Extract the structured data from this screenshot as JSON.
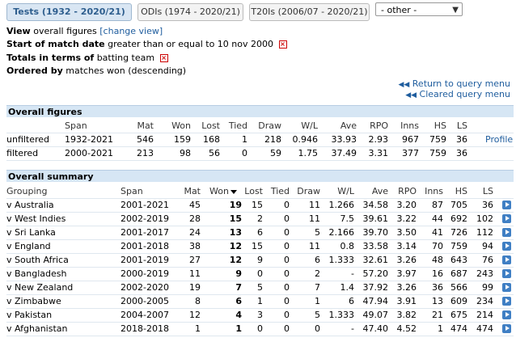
{
  "tabs": [
    {
      "label": "Tests (1932 - 2020/21)",
      "active": true
    },
    {
      "label": "ODIs (1974 - 2020/21)",
      "active": false
    },
    {
      "label": "T20Is (2006/07 - 2020/21)",
      "active": false
    }
  ],
  "other_select": "- other -",
  "criteria": {
    "view_label": "View",
    "view_value": "overall figures",
    "change_view": "[change view]",
    "start_label": "Start of match date",
    "start_value": "greater than or equal to 10 nov 2000",
    "totals_label": "Totals in terms of",
    "totals_value": "batting team",
    "ordered_label": "Ordered by",
    "ordered_value": "matches won (descending)"
  },
  "links": {
    "return_query": "Return to query menu",
    "cleared_query": "Cleared query menu"
  },
  "overall_figures": {
    "title": "Overall figures",
    "headers": [
      "Span",
      "Mat",
      "Won",
      "Lost",
      "Tied",
      "Draw",
      "W/L",
      "Ave",
      "RPO",
      "Inns",
      "HS",
      "LS"
    ],
    "rows": [
      {
        "label": "unfiltered",
        "cells": [
          "1932-2021",
          "546",
          "159",
          "168",
          "1",
          "218",
          "0.946",
          "33.93",
          "2.93",
          "967",
          "759",
          "36"
        ],
        "link": "Profile"
      },
      {
        "label": "filtered",
        "cells": [
          "2000-2021",
          "213",
          "98",
          "56",
          "0",
          "59",
          "1.75",
          "37.49",
          "3.31",
          "377",
          "759",
          "36"
        ],
        "link": ""
      }
    ]
  },
  "overall_summary": {
    "title": "Overall summary",
    "headers": [
      "Grouping",
      "Span",
      "Mat",
      "Won",
      "Lost",
      "Tied",
      "Draw",
      "W/L",
      "Ave",
      "RPO",
      "Inns",
      "HS",
      "LS"
    ],
    "rows": [
      [
        "v Australia",
        "2001-2021",
        "45",
        "19",
        "15",
        "0",
        "11",
        "1.266",
        "34.58",
        "3.20",
        "87",
        "705",
        "36"
      ],
      [
        "v West Indies",
        "2002-2019",
        "28",
        "15",
        "2",
        "0",
        "11",
        "7.5",
        "39.61",
        "3.22",
        "44",
        "692",
        "102"
      ],
      [
        "v Sri Lanka",
        "2001-2017",
        "24",
        "13",
        "6",
        "0",
        "5",
        "2.166",
        "39.70",
        "3.50",
        "41",
        "726",
        "112"
      ],
      [
        "v England",
        "2001-2018",
        "38",
        "12",
        "15",
        "0",
        "11",
        "0.8",
        "33.58",
        "3.14",
        "70",
        "759",
        "94"
      ],
      [
        "v South Africa",
        "2001-2019",
        "27",
        "12",
        "9",
        "0",
        "6",
        "1.333",
        "32.61",
        "3.26",
        "48",
        "643",
        "76"
      ],
      [
        "v Bangladesh",
        "2000-2019",
        "11",
        "9",
        "0",
        "0",
        "2",
        "-",
        "57.20",
        "3.97",
        "16",
        "687",
        "243"
      ],
      [
        "v New Zealand",
        "2002-2020",
        "19",
        "7",
        "5",
        "0",
        "7",
        "1.4",
        "37.92",
        "3.26",
        "36",
        "566",
        "99"
      ],
      [
        "v Zimbabwe",
        "2000-2005",
        "8",
        "6",
        "1",
        "0",
        "1",
        "6",
        "47.94",
        "3.91",
        "13",
        "609",
        "234"
      ],
      [
        "v Pakistan",
        "2004-2007",
        "12",
        "4",
        "3",
        "0",
        "5",
        "1.333",
        "49.07",
        "3.82",
        "21",
        "675",
        "214"
      ],
      [
        "v Afghanistan",
        "2018-2018",
        "1",
        "1",
        "0",
        "0",
        "0",
        "-",
        "47.40",
        "4.52",
        "1",
        "474",
        "474"
      ]
    ]
  }
}
